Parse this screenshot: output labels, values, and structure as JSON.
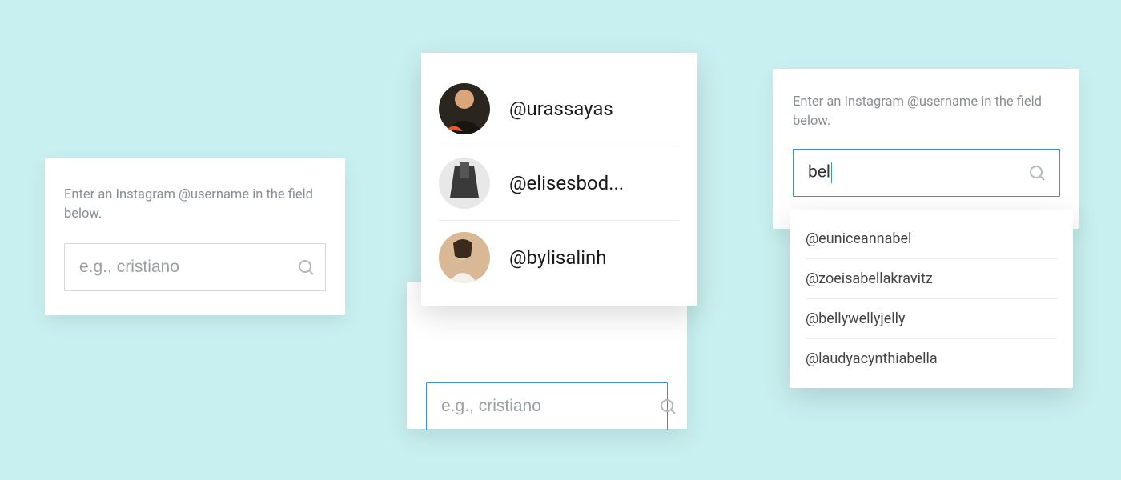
{
  "card1": {
    "instruction": "Enter an Instagram @username in the field below.",
    "placeholder": "e.g., cristiano",
    "value": ""
  },
  "card2": {
    "placeholder": "e.g., cristiano",
    "value": "",
    "results": [
      {
        "handle": "@urassayas"
      },
      {
        "handle": "@elisesbod..."
      },
      {
        "handle": "@bylisalinh"
      }
    ]
  },
  "card3": {
    "instruction": "Enter an Instagram @username in the field below.",
    "value": "bel",
    "suggestions": [
      "@euniceannabel",
      "@zoeisabellakravitz",
      "@bellywellyjelly",
      "@laudyacynthiabella"
    ]
  }
}
